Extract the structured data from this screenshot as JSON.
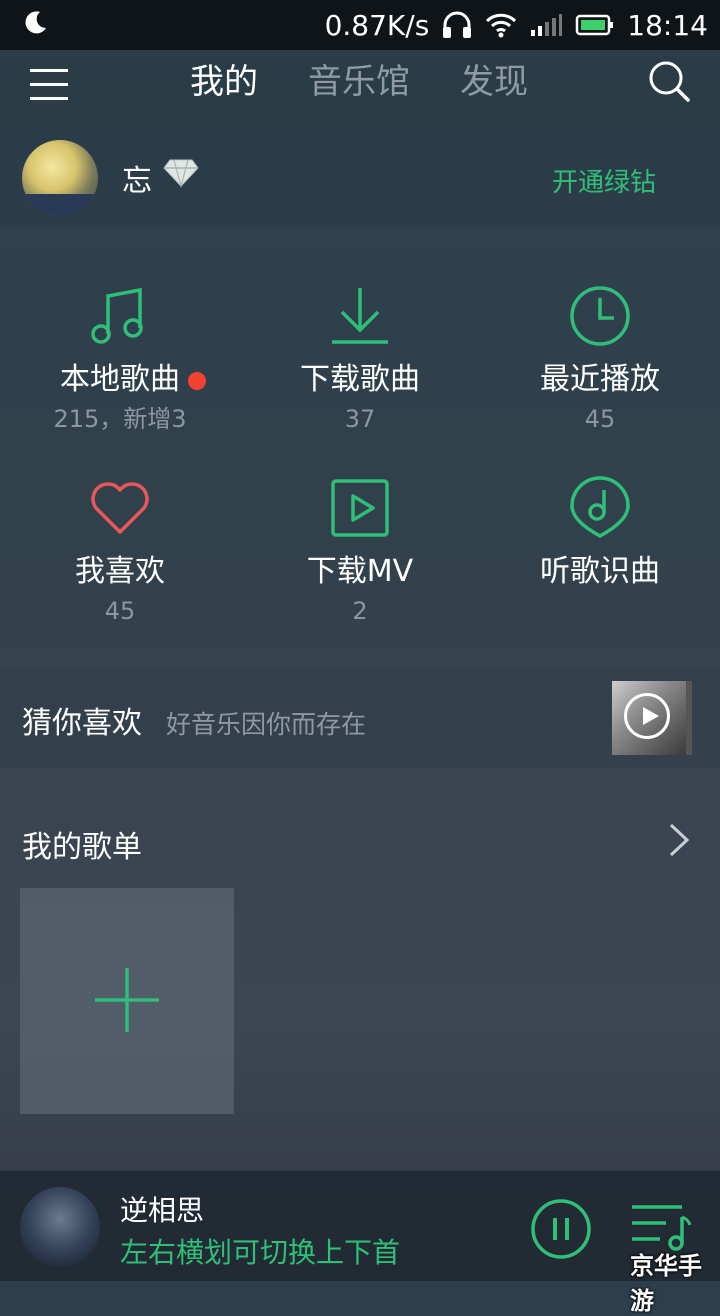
{
  "status_bar": {
    "speed": "0.87K/s",
    "time": "18:14"
  },
  "nav": {
    "tabs": [
      {
        "label": "我的"
      },
      {
        "label": "音乐馆"
      },
      {
        "label": "发现"
      }
    ]
  },
  "profile": {
    "name": "忘",
    "vip_link": "开通绿钻"
  },
  "grid": [
    {
      "label": "本地歌曲",
      "count": "215，新增3",
      "icon": "music-note-icon"
    },
    {
      "label": "下载歌曲",
      "count": "37",
      "icon": "download-icon"
    },
    {
      "label": "最近播放",
      "count": "45",
      "icon": "clock-icon"
    },
    {
      "label": "我喜欢",
      "count": "45",
      "icon": "heart-icon"
    },
    {
      "label": "下载MV",
      "count": "2",
      "icon": "video-play-icon"
    },
    {
      "label": "听歌识曲",
      "count": "",
      "icon": "recognize-icon"
    }
  ],
  "guess": {
    "title": "猜你喜欢",
    "subtitle": "好音乐因你而存在"
  },
  "playlists": {
    "title": "我的歌单"
  },
  "player": {
    "song": "逆相思",
    "hint": "左右横划可切换上下首"
  },
  "watermark": "京华手游",
  "colors": {
    "accent": "#2fbf78",
    "heart": "#e8585a",
    "badge": "#f2422f"
  }
}
